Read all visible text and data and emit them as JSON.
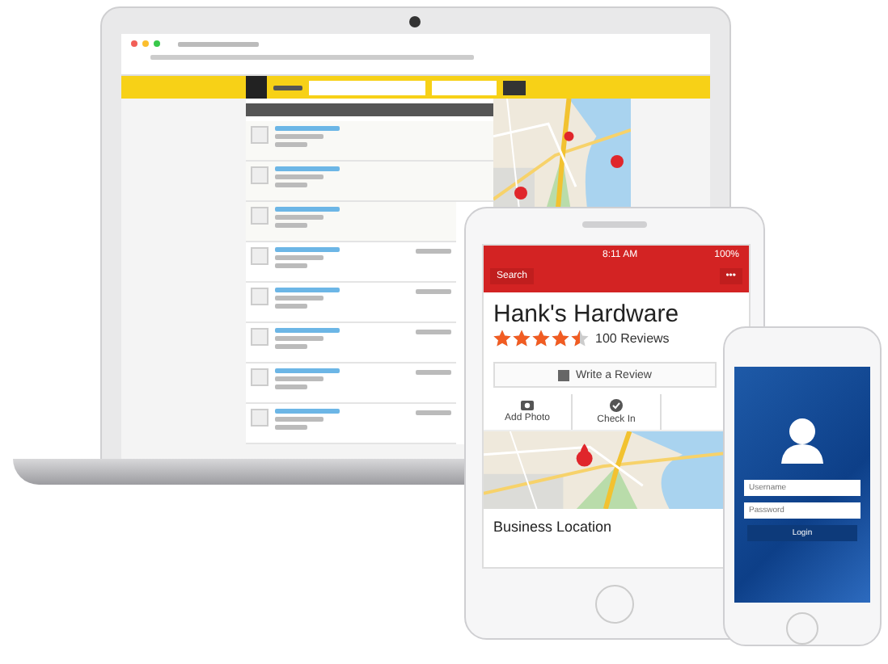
{
  "tablet": {
    "status": {
      "time": "8:11 AM",
      "battery": "100%"
    },
    "nav": {
      "back": "Search",
      "menu": "•••"
    },
    "business": {
      "name": "Hank's Hardware",
      "stars": 4.5,
      "reviews": "100 Reviews"
    },
    "write_review": "Write a Review",
    "actions": [
      {
        "label": "Add Photo",
        "kind": "camera"
      },
      {
        "label": "Check In",
        "kind": "check"
      }
    ],
    "location_label": "Business Location"
  },
  "phone": {
    "username": {
      "placeholder": "Username"
    },
    "password": {
      "placeholder": "Password"
    },
    "login": "Login"
  }
}
